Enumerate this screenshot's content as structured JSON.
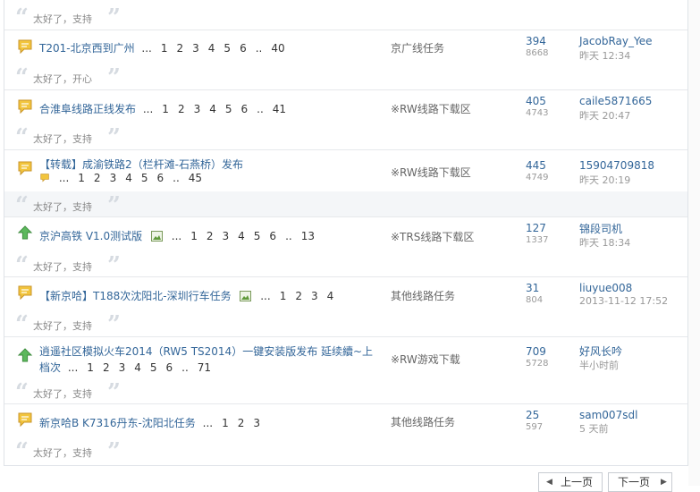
{
  "reply_text": "太好了，支持",
  "threads": [
    {
      "title": "T201-北京西到广州",
      "pages": [
        "1",
        "2",
        "3",
        "4",
        "5",
        "6",
        ".."
      ],
      "last_page": "40",
      "forum": "京广线任务",
      "replies": "394",
      "views": "8668",
      "last_user": "JacobRay_Yee",
      "last_time": "昨天 12:34",
      "quote": "太好了，开心"
    },
    {
      "title": "合淮阜线路正线发布",
      "pages": [
        "1",
        "2",
        "3",
        "4",
        "5",
        "6",
        ".."
      ],
      "last_page": "41",
      "forum": "※RW线路下载区",
      "replies": "405",
      "views": "4743",
      "last_user": "caile5871665",
      "last_time": "昨天 20:47",
      "quote": "太好了，支持"
    },
    {
      "title": "【转载】成渝铁路2（栏杆滩-石燕桥）发布",
      "pages": [
        "1",
        "2",
        "3",
        "4",
        "5",
        "6",
        ".."
      ],
      "last_page": "45",
      "forum": "※RW线路下载区",
      "replies": "445",
      "views": "4749",
      "last_user": "15904709818",
      "last_time": "昨天 20:19",
      "quote": "太好了，支持"
    },
    {
      "title": "京沪高铁 V1.0测试版",
      "pages": [
        "1",
        "2",
        "3",
        "4",
        "5",
        "6",
        ".."
      ],
      "last_page": "13",
      "forum": "※TRS线路下载区",
      "replies": "127",
      "views": "1337",
      "last_user": "锦段司机",
      "last_time": "昨天 18:34",
      "quote": "太好了，支持"
    },
    {
      "title": "【新京哈】T188次沈阳北-深圳行车任务",
      "pages": [
        "1",
        "2",
        "3"
      ],
      "last_page": "4",
      "forum": "其他线路任务",
      "replies": "31",
      "views": "804",
      "last_user": "liuyue008",
      "last_time": "2013-11-12 17:52",
      "quote": "太好了，支持"
    },
    {
      "title_line1": "逍遥社区模拟火车2014（RW5 TS2014）一键安装版发布 延续續~上",
      "title_line2": "档次",
      "pages": [
        "1",
        "2",
        "3",
        "4",
        "5",
        "6",
        ".."
      ],
      "last_page": "71",
      "forum": "※RW游戏下载",
      "replies": "709",
      "views": "5728",
      "last_user": "好风长吟",
      "last_time": "半小时前",
      "quote": "太好了，支持"
    },
    {
      "title": "新京哈B K7316丹东-沈阳北任务",
      "pages": [
        "1",
        "2"
      ],
      "last_page": "3",
      "forum": "其他线路任务",
      "replies": "25",
      "views": "597",
      "last_user": "sam007sdl",
      "last_time": "5 天前",
      "quote": "太好了，支持"
    }
  ],
  "pager": {
    "prev": "上一页",
    "next": "下一页"
  },
  "colors": {
    "link": "#336699",
    "muted": "#999999",
    "quote_mark": "#d6dbe1",
    "icon_yellow": "#f2c53d",
    "icon_green": "#5cb85c"
  },
  "icons": {
    "thread_normal": "speech-bubble-icon",
    "thread_hot": "up-arrow-icon",
    "attachment": "image-attachment-icon",
    "prev": "chevron-left-icon",
    "next": "chevron-right-icon"
  }
}
